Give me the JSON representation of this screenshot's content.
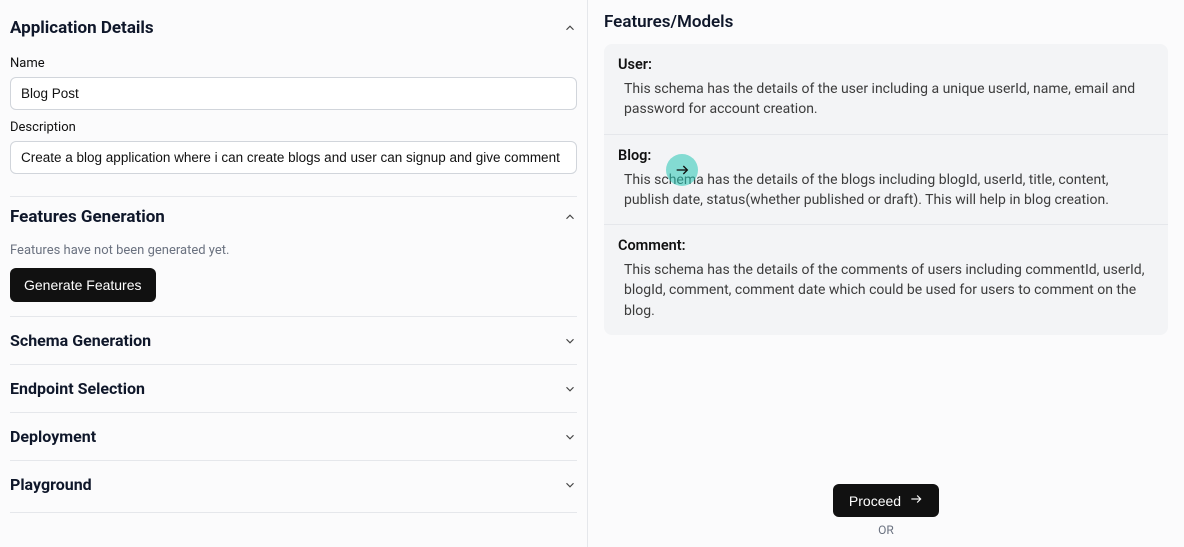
{
  "left": {
    "appDetails": {
      "title": "Application Details",
      "nameLabel": "Name",
      "nameValue": "Blog Post",
      "descLabel": "Description",
      "descValue": "Create a blog application where i can create blogs and user can signup and give comment"
    },
    "featuresGen": {
      "title": "Features Generation",
      "help": "Features have not been generated yet.",
      "button": "Generate Features"
    },
    "sections": {
      "schema": "Schema Generation",
      "endpoint": "Endpoint Selection",
      "deployment": "Deployment",
      "playground": "Playground"
    }
  },
  "right": {
    "title": "Features/Models",
    "models": [
      {
        "name": "User:",
        "desc": "This schema has the details of the user including a unique userId, name, email and password for account creation."
      },
      {
        "name": "Blog:",
        "desc": "This schema has the details of the blogs including blogId, userId, title, content, publish date, status(whether published or draft). This will help in blog creation."
      },
      {
        "name": "Comment:",
        "desc": "This schema has the details of the comments of users including commentId, userId, blogId, comment, comment date which could be used for users to comment on the blog."
      }
    ],
    "proceed": "Proceed",
    "or": "OR"
  }
}
